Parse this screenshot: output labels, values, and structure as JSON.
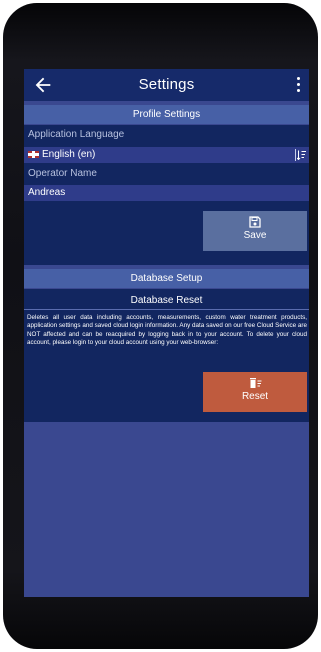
{
  "appbar": {
    "title": "Settings"
  },
  "profile": {
    "header": "Profile Settings",
    "language_label": "Application Language",
    "language_value": "English (en)",
    "operator_label": "Operator Name",
    "operator_value": "Andreas",
    "save_label": "Save"
  },
  "database": {
    "header": "Database Setup",
    "reset_title": "Database Reset",
    "reset_description": "Deletes all user data including accounts, measurements, custom water treatment products, application settings and saved cloud login information. Any data saved on our free Cloud Service are NOT affected and can be reacquired by logging back in to your account. To delete your cloud account, please login to your cloud account using your web-browser:",
    "reset_label": "Reset"
  },
  "colors": {
    "appbar": "#162a6a",
    "section_header": "#4760a6",
    "dark_panel": "#122660",
    "screen_bg": "#3a4890",
    "save_button": "#5a6f9f",
    "reset_button": "#bf5b3e"
  },
  "icons": [
    "back-arrow-icon",
    "more-vert-icon",
    "uk-flag-icon",
    "sort-icon",
    "save-icon",
    "delete-icon"
  ]
}
